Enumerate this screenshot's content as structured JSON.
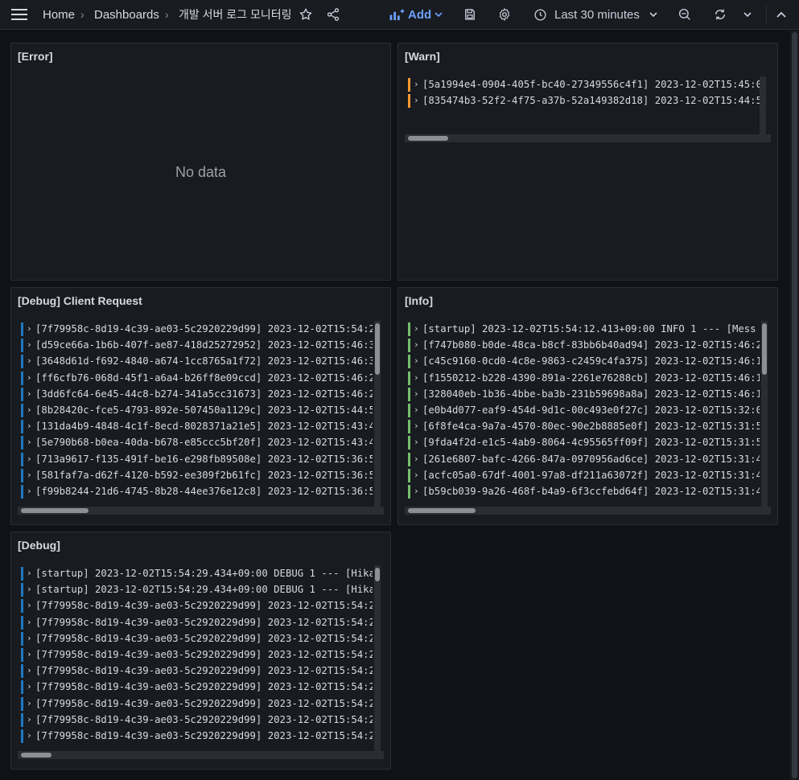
{
  "nav": {
    "home": "Home",
    "dashboards": "Dashboards",
    "title": "개발 서버 로그 모니터링",
    "add_label": "Add",
    "time_range": "Last 30 minutes"
  },
  "colors": {
    "bg": "#111217",
    "panel_bg": "#181b1f",
    "accent": "#6e9fff",
    "warn": "#ff9830",
    "info": "#73bf69",
    "debug": "#1f78c1"
  },
  "panels": {
    "error": {
      "title": "[Error]",
      "empty_text": "No data"
    },
    "warn": {
      "title": "[Warn]",
      "level_color": "#ff9830",
      "lines": [
        "[5a1994e4-0904-405f-bc40-27349556c4f1] 2023-12-02T15:45:0",
        "[835474b3-52f2-4f75-a37b-52a149382d18] 2023-12-02T15:44:5"
      ]
    },
    "debug_client": {
      "title": "[Debug] Client Request",
      "level_color": "#1f78c1",
      "lines": [
        "[7f79958c-8d19-4c39-ae03-5c2920229d99] 2023-12-02T15:54:2",
        "[d59ce66a-1b6b-407f-ae87-418d25272952] 2023-12-02T15:46:3",
        "[3648d61d-f692-4840-a674-1cc8765a1f72] 2023-12-02T15:46:3",
        "[ff6cfb76-068d-45f1-a6a4-b26ff8e09ccd] 2023-12-02T15:46:2",
        "[3dd6fc64-6e45-44c8-b274-341a5cc31673] 2023-12-02T15:46:2",
        "[8b28420c-fce5-4793-892e-507450a1129c] 2023-12-02T15:44:5",
        "[131da4b9-4848-4c1f-8ecd-8028371a21e5] 2023-12-02T15:43:4",
        "[5e790b68-b0ea-40da-b678-e85ccc5bf20f] 2023-12-02T15:43:4",
        "[713a9617-f135-491f-be16-e298fb89508e] 2023-12-02T15:36:5",
        "[581faf7a-d62f-4120-b592-ee309f2b61fc] 2023-12-02T15:36:5",
        "[f99b8244-21d6-4745-8b28-44ee376e12c8] 2023-12-02T15:36:5"
      ]
    },
    "info": {
      "title": "[Info]",
      "level_color": "#73bf69",
      "lines": [
        "[startup] 2023-12-02T15:54:12.413+09:00  INFO 1 --- [Mess",
        "[f747b080-b0de-48ca-b8cf-83bb6b40ad94] 2023-12-02T15:46:2",
        "[c45c9160-0cd0-4c8e-9863-c2459c4fa375] 2023-12-02T15:46:1",
        "[f1550212-b228-4390-891a-2261e76288cb] 2023-12-02T15:46:1",
        "[328040eb-1b36-4bbe-ba3b-231b59698a8a] 2023-12-02T15:46:1",
        "[e0b4d077-eaf9-454d-9d1c-00c493e0f27c] 2023-12-02T15:32:0",
        "[6f8fe4ca-9a7a-4570-80ec-90e2b8885e0f] 2023-12-02T15:31:5",
        "[9fda4f2d-e1c5-4ab9-8064-4c95565ff09f] 2023-12-02T15:31:5",
        "[261e6807-bafc-4266-847a-0970956ad6ce] 2023-12-02T15:31:4",
        "[acfc05a0-67df-4001-97a8-df211a63072f] 2023-12-02T15:31:4",
        "[b59cb039-9a26-468f-b4a9-6f3ccfebd64f] 2023-12-02T15:31:4"
      ]
    },
    "debug": {
      "title": "[Debug]",
      "level_color": "#1f78c1",
      "lines": [
        "[startup] 2023-12-02T15:54:29.434+09:00 DEBUG 1 --- [Hika",
        "[startup] 2023-12-02T15:54:29.434+09:00 DEBUG 1 --- [Hika",
        "[7f79958c-8d19-4c39-ae03-5c2920229d99] 2023-12-02T15:54:2",
        "[7f79958c-8d19-4c39-ae03-5c2920229d99] 2023-12-02T15:54:2",
        "[7f79958c-8d19-4c39-ae03-5c2920229d99] 2023-12-02T15:54:2",
        "[7f79958c-8d19-4c39-ae03-5c2920229d99] 2023-12-02T15:54:2",
        "[7f79958c-8d19-4c39-ae03-5c2920229d99] 2023-12-02T15:54:2",
        "[7f79958c-8d19-4c39-ae03-5c2920229d99] 2023-12-02T15:54:2",
        "[7f79958c-8d19-4c39-ae03-5c2920229d99] 2023-12-02T15:54:2",
        "[7f79958c-8d19-4c39-ae03-5c2920229d99] 2023-12-02T15:54:2",
        "[7f79958c-8d19-4c39-ae03-5c2920229d99] 2023-12-02T15:54:2"
      ]
    }
  }
}
